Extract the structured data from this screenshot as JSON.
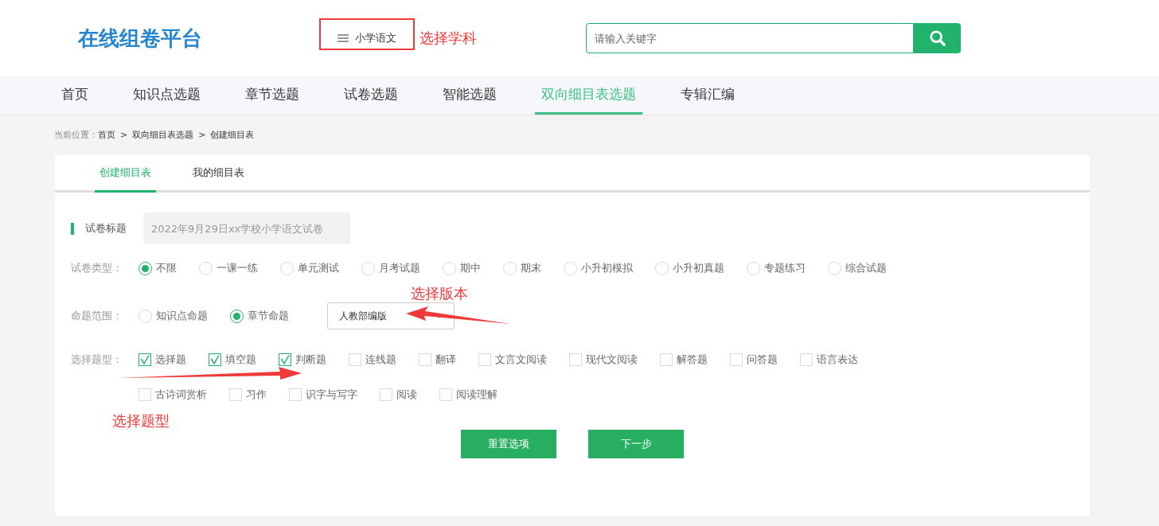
{
  "header": {
    "logo": "在线组卷平台",
    "subject": "小学语文",
    "search": {
      "placeholder": "请输入关键字"
    }
  },
  "nav": [
    {
      "label": "首页",
      "selected": false
    },
    {
      "label": "知识点选题",
      "selected": false
    },
    {
      "label": "章节选题",
      "selected": false
    },
    {
      "label": "试卷选题",
      "selected": false
    },
    {
      "label": "智能选题",
      "selected": false
    },
    {
      "label": "双向细目表选题",
      "selected": true
    },
    {
      "label": "专辑汇编",
      "selected": false
    }
  ],
  "breadcrumb": {
    "label": "当前位置：",
    "items": [
      "首页",
      "双向细目表选题",
      "创建细目表"
    ],
    "separator": ">"
  },
  "tabs": [
    {
      "label": "创建细目表",
      "selected": true
    },
    {
      "label": "我的细目表",
      "selected": false
    }
  ],
  "form": {
    "title": {
      "label": "试卷标题",
      "placeholder": "2022年9月29日xx学校小学语文试卷"
    },
    "paper_type": {
      "label": "试卷类型：",
      "options": [
        {
          "label": "不限",
          "selected": true
        },
        {
          "label": "一课一练",
          "selected": false
        },
        {
          "label": "单元测试",
          "selected": false
        },
        {
          "label": "月考试题",
          "selected": false
        },
        {
          "label": "期中",
          "selected": false
        },
        {
          "label": "期末",
          "selected": false
        },
        {
          "label": "小升初模拟",
          "selected": false
        },
        {
          "label": "小升初真题",
          "selected": false
        },
        {
          "label": "专题练习",
          "selected": false
        },
        {
          "label": "综合试题",
          "selected": false
        }
      ]
    },
    "scope": {
      "label": "命题范围：",
      "options": [
        {
          "label": "知识点命题",
          "selected": false
        },
        {
          "label": "章节命题",
          "selected": true
        }
      ],
      "edition": "人教部编版"
    },
    "question_types": {
      "label": "选择题型：",
      "rows": [
        [
          {
            "label": "选择题",
            "checked": true
          },
          {
            "label": "填空题",
            "checked": true
          },
          {
            "label": "判断题",
            "checked": true
          },
          {
            "label": "连线题",
            "checked": false
          },
          {
            "label": "翻译",
            "checked": false
          },
          {
            "label": "文言文阅读",
            "checked": false
          },
          {
            "label": "现代文阅读",
            "checked": false
          },
          {
            "label": "解答题",
            "checked": false
          },
          {
            "label": "问答题",
            "checked": false
          },
          {
            "label": "语言表达",
            "checked": false
          }
        ],
        [
          {
            "label": "古诗词赏析",
            "checked": false
          },
          {
            "label": "习作",
            "checked": false
          },
          {
            "label": "识字与写字",
            "checked": false
          },
          {
            "label": "阅读",
            "checked": false
          },
          {
            "label": "阅读理解",
            "checked": false
          }
        ]
      ]
    },
    "buttons": [
      "重置选项",
      "下一步"
    ]
  },
  "annotations": [
    "选择学科",
    "选择版本",
    "选择题型"
  ]
}
